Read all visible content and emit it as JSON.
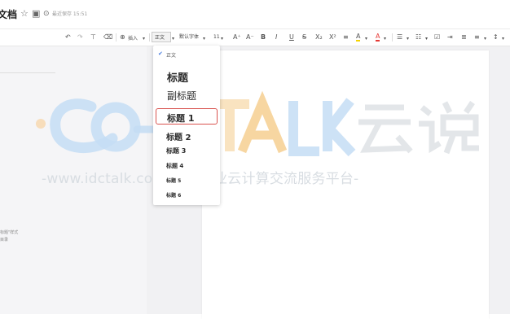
{
  "titlebar": {
    "doc_title": "文档",
    "saved_text": "最近保存 15:51"
  },
  "toolbar": {
    "undo": "↶",
    "redo": "↷",
    "format_painter": "⊤",
    "clear_format": "⌫",
    "insert_label": "插入",
    "style_value": "正文",
    "font_value": "默认字体",
    "size_value": "11",
    "grow_font": "A⁺",
    "shrink_font": "A⁻",
    "bold": "B",
    "italic": "I",
    "underline": "U",
    "strikethrough": "S",
    "subscript": "X₂",
    "superscript": "X²",
    "highlight": "A",
    "font_color": "A"
  },
  "style_menu": {
    "items": [
      "正文",
      "标题",
      "副标题",
      "标题 1",
      "标题 2",
      "标题 3",
      "标题 4",
      "标题 5",
      "标题 6"
    ],
    "selected": "正文",
    "highlighted": "标题 1"
  },
  "left_panel": {
    "hint_line1": "标题\"样式",
    "hint_line2": "目录"
  },
  "watermark": {
    "brand": "TALK 云说",
    "url_text": "-www.idctalk.com-国内专业云计算交流服务平台-"
  },
  "colors": {
    "accent_blue": "#4a7de0",
    "highlight_red": "#d9534f",
    "highlight_yellow": "#f5d300",
    "font_color_red": "#e53935",
    "watermark_blue": "#7fb3e6",
    "watermark_orange": "#f8b34a"
  }
}
